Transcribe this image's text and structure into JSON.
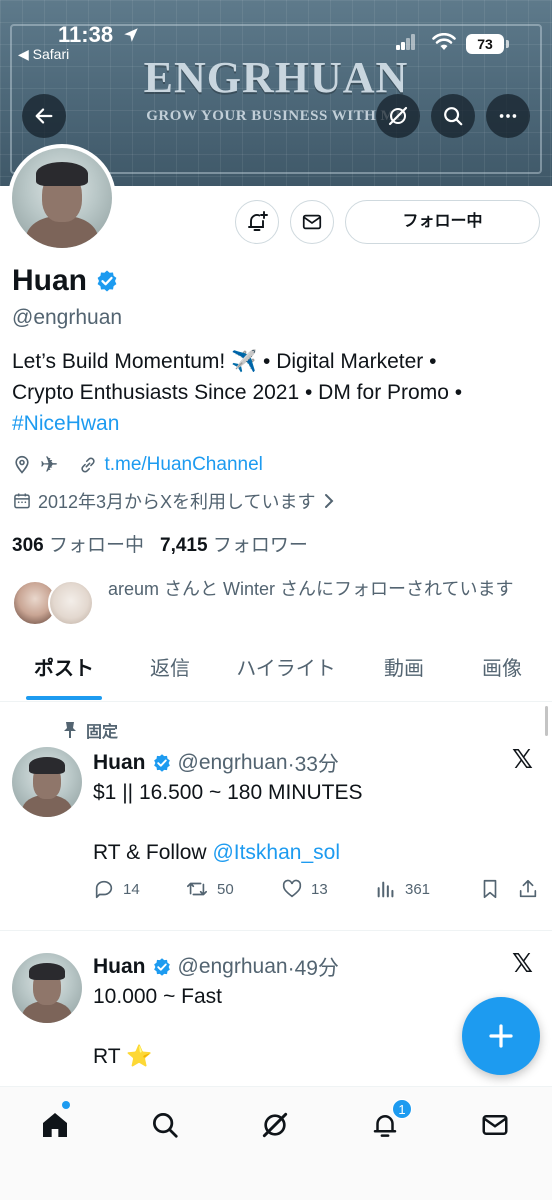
{
  "status_bar": {
    "time": "11:38",
    "back_app": "◀ Safari",
    "battery": "73"
  },
  "banner": {
    "title": "ENGRHUAN",
    "subtitle": "GROW YOUR BUSINESS WITH ME"
  },
  "header_buttons": {
    "back_icon": "arrow-left-icon",
    "grok_icon": "grok-icon",
    "search_icon": "search-icon",
    "more_icon": "more-icon"
  },
  "profile": {
    "name": "Huan",
    "verified": true,
    "handle": "@engrhuan",
    "bio_line1": "Let’s Build Momentum! ✈️ • Digital Marketer •",
    "bio_line2": "Crypto Enthusiasts Since 2021 • DM for Promo •",
    "bio_hashtag": "#NiceHwan",
    "location": "✈",
    "link": "t.me/HuanChannel",
    "joined": "2012年3月からXを利用しています",
    "following_count": "306",
    "following_label": "フォロー中",
    "followers_count": "7,415",
    "followers_label": "フォロワー",
    "followed_by": "areum さんと Winter さんにフォローされています"
  },
  "actions": {
    "follow_button": "フォロー中"
  },
  "tabs": [
    {
      "label": "ポスト",
      "active": true
    },
    {
      "label": "返信",
      "active": false
    },
    {
      "label": "ハイライト",
      "active": false
    },
    {
      "label": "動画",
      "active": false
    },
    {
      "label": "画像",
      "active": false
    }
  ],
  "posts": [
    {
      "pinned_label": "固定",
      "name": "Huan",
      "handle": "@engrhuan",
      "time": "·33分",
      "line1": "$1 || 16.500 ~ 180 MINUTES",
      "line2_prefix": "RT & Follow ",
      "line2_mention": "@Itskhan_sol",
      "replies": "14",
      "reposts": "50",
      "likes": "13",
      "views": "361"
    },
    {
      "name": "Huan",
      "handle": "@engrhuan",
      "time": "·49分",
      "line1": "10.000 ~ Fast",
      "line2": "RT ⭐"
    }
  ],
  "bottom_nav": {
    "items": [
      "home-icon",
      "search-icon",
      "grok-icon",
      "notifications-icon",
      "messages-icon"
    ],
    "notification_badge": "1"
  },
  "colors": {
    "accent": "#1d9bf0",
    "text": "#0f1419",
    "secondary": "#536471"
  }
}
